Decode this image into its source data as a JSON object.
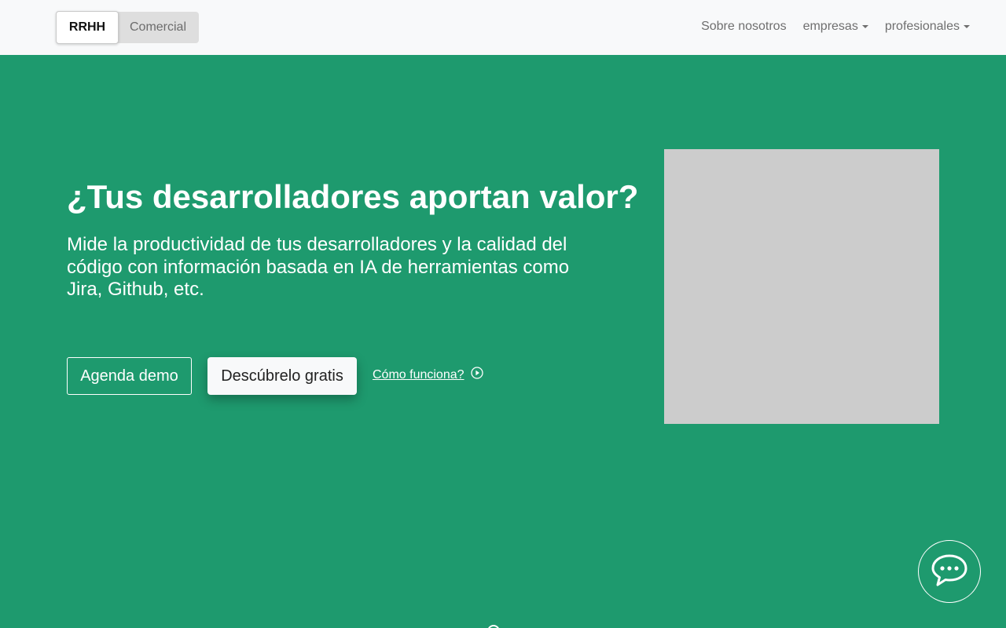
{
  "navbar": {
    "segments": [
      {
        "label": "RRHH",
        "active": true
      },
      {
        "label": "Comercial",
        "active": false
      }
    ],
    "links": [
      {
        "label": "Sobre nosotros",
        "dropdown": false
      },
      {
        "label": "empresas",
        "dropdown": true
      },
      {
        "label": "profesionales",
        "dropdown": true
      }
    ]
  },
  "hero": {
    "title": "¿Tus desarrolladores aportan valor?",
    "subtitle": "Mide la productividad de tus desarrolladores y la calidad del código con información basada en IA de herramientas como Jira, Github, etc.",
    "primary_button": "Agenda demo",
    "secondary_button": "Descúbrelo gratis",
    "how_link": "Cómo funciona?",
    "how_icon": "play-circle-icon"
  },
  "chat": {
    "icon": "chat-bubble-icon"
  },
  "colors": {
    "hero_background": "#1e9a6e",
    "navbar_background": "#f8f9fa",
    "media_placeholder": "#cccccc"
  }
}
